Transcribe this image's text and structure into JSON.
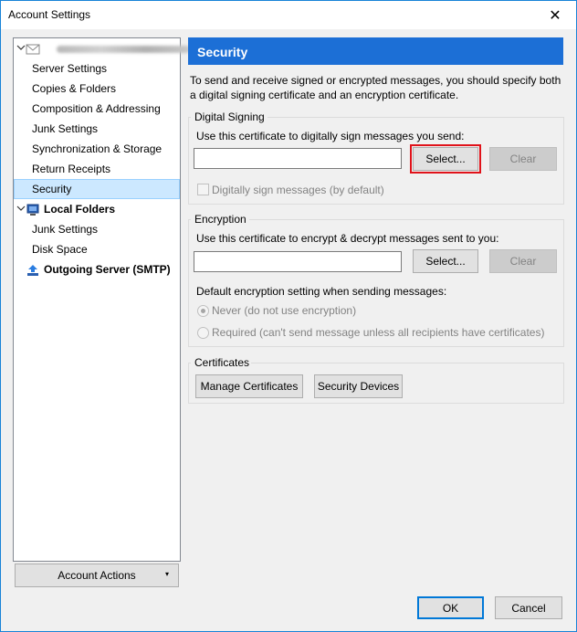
{
  "window": {
    "title": "Account Settings",
    "close_glyph": "✕"
  },
  "tree": {
    "items": [
      {
        "label": "",
        "kind": "account",
        "icon": "mail-icon",
        "expanded": true
      },
      {
        "label": "Server Settings"
      },
      {
        "label": "Copies & Folders"
      },
      {
        "label": "Composition & Addressing"
      },
      {
        "label": "Junk Settings"
      },
      {
        "label": "Synchronization & Storage"
      },
      {
        "label": "Return Receipts"
      },
      {
        "label": "Security",
        "selected": true
      },
      {
        "label": "Local Folders",
        "icon": "local-folders-icon",
        "expanded": true
      },
      {
        "label": "Junk Settings"
      },
      {
        "label": "Disk Space"
      },
      {
        "label": "Outgoing Server (SMTP)",
        "icon": "outgoing-server-icon"
      }
    ]
  },
  "account_actions": {
    "label": "Account Actions",
    "arrow": "▾"
  },
  "security": {
    "title": "Security",
    "description": "To send and receive signed or encrypted messages, you should specify both a digital signing certificate and an encryption certificate.",
    "digital_signing": {
      "legend": "Digital Signing",
      "prompt": "Use this certificate to digitally sign messages you send:",
      "value": "",
      "select_label": "Select...",
      "clear_label": "Clear",
      "checkbox_label": "Digitally sign messages (by default)",
      "checkbox_checked": false
    },
    "encryption": {
      "legend": "Encryption",
      "prompt": "Use this certificate to encrypt & decrypt messages sent to you:",
      "value": "",
      "select_label": "Select...",
      "clear_label": "Clear",
      "default_setting_label": "Default encryption setting when sending messages:",
      "options": [
        {
          "label": "Never (do not use encryption)",
          "checked": true
        },
        {
          "label": "Required (can't send message unless all recipients have certificates)",
          "checked": false
        }
      ]
    },
    "certificates": {
      "legend": "Certificates",
      "manage_label": "Manage Certificates",
      "devices_label": "Security Devices"
    }
  },
  "footer": {
    "ok_label": "OK",
    "cancel_label": "Cancel"
  },
  "colors": {
    "header_bg": "#1c6fd6",
    "selection_bg": "#cce8ff",
    "highlight_outline": "#e0121a",
    "default_button_border": "#0078d7"
  }
}
